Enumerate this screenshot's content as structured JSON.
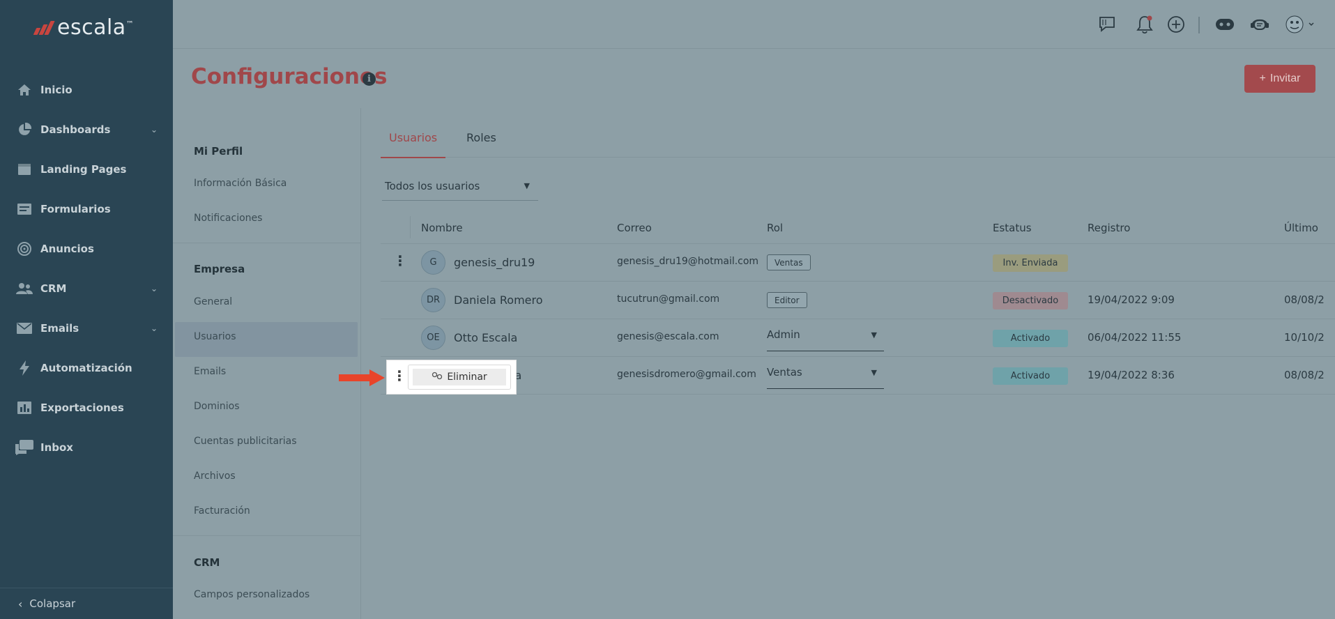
{
  "brand": {
    "name": "escala",
    "trademark": "™",
    "accent": "#c9453f"
  },
  "sidebar": {
    "items": [
      {
        "label": "Inicio",
        "icon": "home-icon",
        "has_chevron": false
      },
      {
        "label": "Dashboards",
        "icon": "pie-chart-icon",
        "has_chevron": true
      },
      {
        "label": "Landing Pages",
        "icon": "browser-window-icon",
        "has_chevron": false
      },
      {
        "label": "Formularios",
        "icon": "form-icon",
        "has_chevron": false
      },
      {
        "label": "Anuncios",
        "icon": "target-icon",
        "has_chevron": false
      },
      {
        "label": "CRM",
        "icon": "users-icon",
        "has_chevron": true
      },
      {
        "label": "Emails",
        "icon": "envelope-icon",
        "has_chevron": true
      },
      {
        "label": "Automatización",
        "icon": "lightning-icon",
        "has_chevron": false
      },
      {
        "label": "Exportaciones",
        "icon": "bar-chart-icon",
        "has_chevron": false
      },
      {
        "label": "Inbox",
        "icon": "chat-bubbles-icon",
        "has_chevron": false
      }
    ],
    "collapse_label": "Colapsar"
  },
  "topbar": {
    "icons": [
      "chat-icon",
      "bell-icon",
      "plus-circle-icon",
      "robot-icon",
      "support-agent-icon",
      "user-avatar-icon"
    ]
  },
  "header": {
    "title": "Configuraciones",
    "info_glyph": "i",
    "invite_label": "Invitar",
    "invite_plus": "+"
  },
  "settings_menu": {
    "profile_heading": "Mi Perfil",
    "profile_items": [
      "Información Básica",
      "Notificaciones"
    ],
    "company_heading": "Empresa",
    "company_items": [
      "General",
      "Usuarios",
      "Emails",
      "Dominios",
      "Cuentas publicitarias",
      "Archivos",
      "Facturación"
    ],
    "crm_heading": "CRM",
    "crm_items": [
      "Campos personalizados"
    ],
    "active_item": "Usuarios"
  },
  "tabs": {
    "users": "Usuarios",
    "roles": "Roles",
    "active": "Usuarios"
  },
  "filter": {
    "selected": "Todos los usuarios"
  },
  "table": {
    "headers": {
      "name": "Nombre",
      "email": "Correo",
      "role": "Rol",
      "status": "Estatus",
      "registered": "Registro",
      "last": "Último"
    },
    "rows": [
      {
        "initials": "G",
        "name": "genesis_dru19",
        "email": "genesis_dru19@hotmail.com",
        "role": "Ventas",
        "role_type": "chip",
        "status": "Inv. Enviada",
        "status_kind": "inv",
        "registered": "",
        "last": "",
        "has_kebab": true
      },
      {
        "initials": "DR",
        "name": "Daniela Romero",
        "email": "tucutrun@gmail.com",
        "role": "Editor",
        "role_type": "chip",
        "status": "Desactivado",
        "status_kind": "des",
        "registered": "19/04/2022 9:09",
        "last": "08/08/2",
        "has_kebab": false
      },
      {
        "initials": "OE",
        "name": "Otto Escala",
        "email": "genesis@escala.com",
        "role": "Admin",
        "role_type": "select",
        "status": "Activado",
        "status_kind": "act",
        "registered": "06/04/2022 11:55",
        "last": "10/10/2",
        "has_kebab": false
      },
      {
        "initials": "",
        "name": "la",
        "email": "genesisdromero@gmail.com",
        "role": "Ventas",
        "role_type": "select",
        "status": "Activado",
        "status_kind": "act",
        "registered": "19/04/2022 8:36",
        "last": "08/08/2",
        "has_kebab": false
      }
    ]
  },
  "popup": {
    "action_label": "Eliminar",
    "action_icon": "link-icon"
  },
  "annotation": {
    "arrow_color": "#e8442a"
  }
}
